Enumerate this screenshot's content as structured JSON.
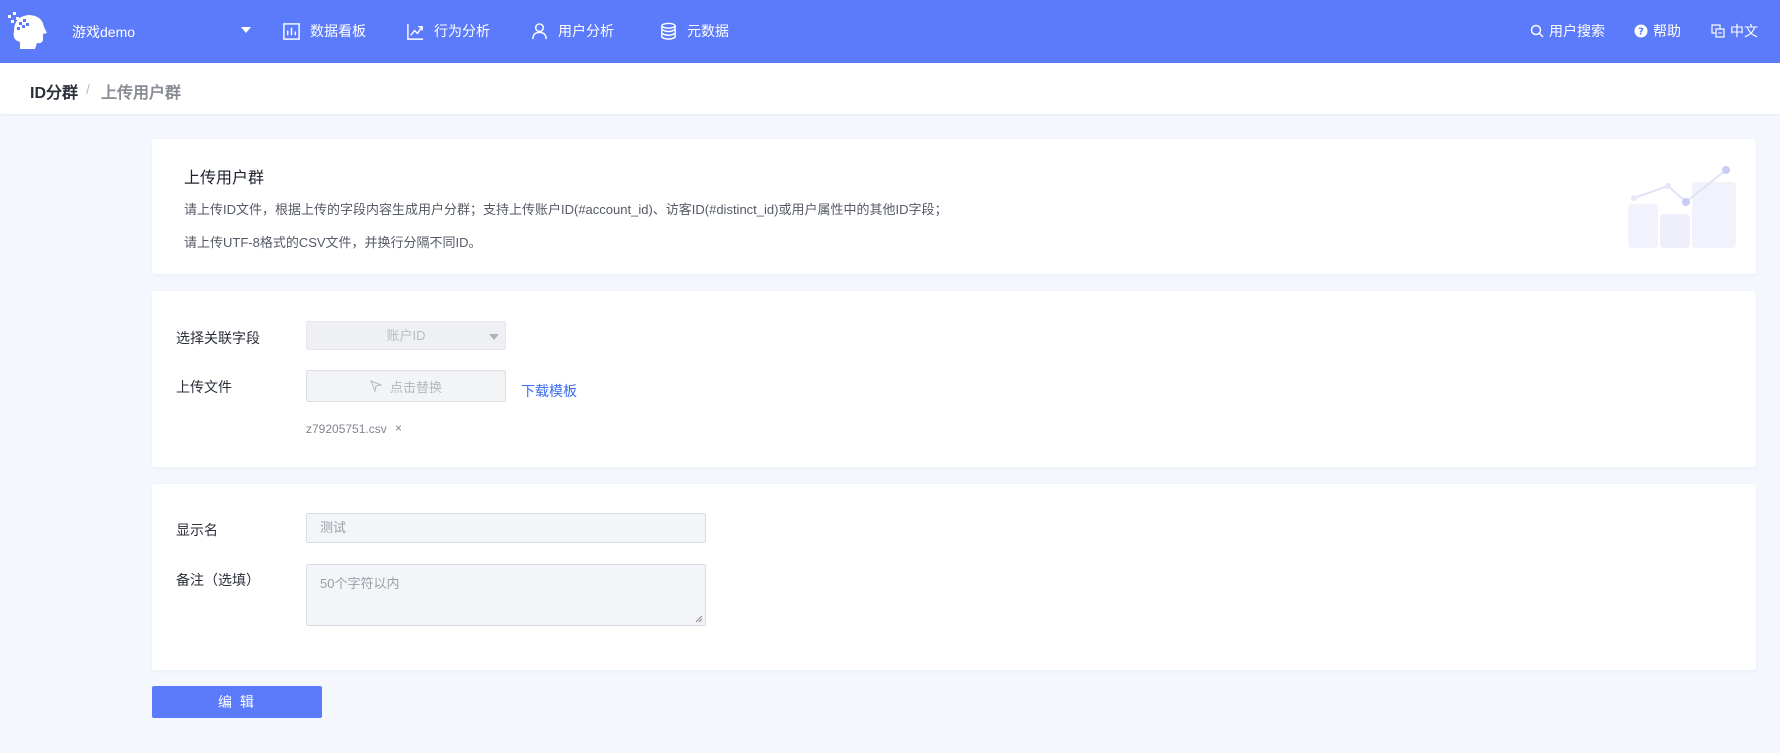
{
  "header": {
    "project_name": "游戏demo",
    "nav": [
      {
        "label": "数据看板",
        "icon": "bar-chart-icon"
      },
      {
        "label": "行为分析",
        "icon": "trend-line-icon"
      },
      {
        "label": "用户分析",
        "icon": "user-icon"
      },
      {
        "label": "元数据",
        "icon": "database-icon"
      }
    ],
    "right": [
      {
        "label": "用户搜索",
        "icon": "search-icon"
      },
      {
        "label": "帮助",
        "icon": "help-icon"
      },
      {
        "label": "中文",
        "icon": "language-icon"
      }
    ],
    "bg_color": "#5b7bfa"
  },
  "breadcrumb": {
    "root": "ID分群",
    "separator": "/",
    "current": "上传用户群"
  },
  "intro": {
    "title": "上传用户群",
    "line1": "请上传ID文件，根据上传的字段内容生成用户分群；支持上传账户ID(#account_id)、访客ID(#distinct_id)或用户属性中的其他ID字段；",
    "line2": "请上传UTF-8格式的CSV文件，并换行分隔不同ID。"
  },
  "upload_form": {
    "field_label": "选择关联字段",
    "field_value": "账户ID",
    "file_label": "上传文件",
    "upload_button": "点击替换",
    "download_link": "下载模板",
    "file_name": "z79205751.csv",
    "remove_symbol": "×"
  },
  "detail_form": {
    "name_label": "显示名",
    "name_value": "测试",
    "remark_label": "备注（选填）",
    "remark_placeholder": "50个字符以内"
  },
  "actions": {
    "edit_button": "编 辑"
  },
  "colors": {
    "primary": "#5b7bfa",
    "link": "#3b6cf6",
    "page_bg": "#f4f7fe"
  }
}
